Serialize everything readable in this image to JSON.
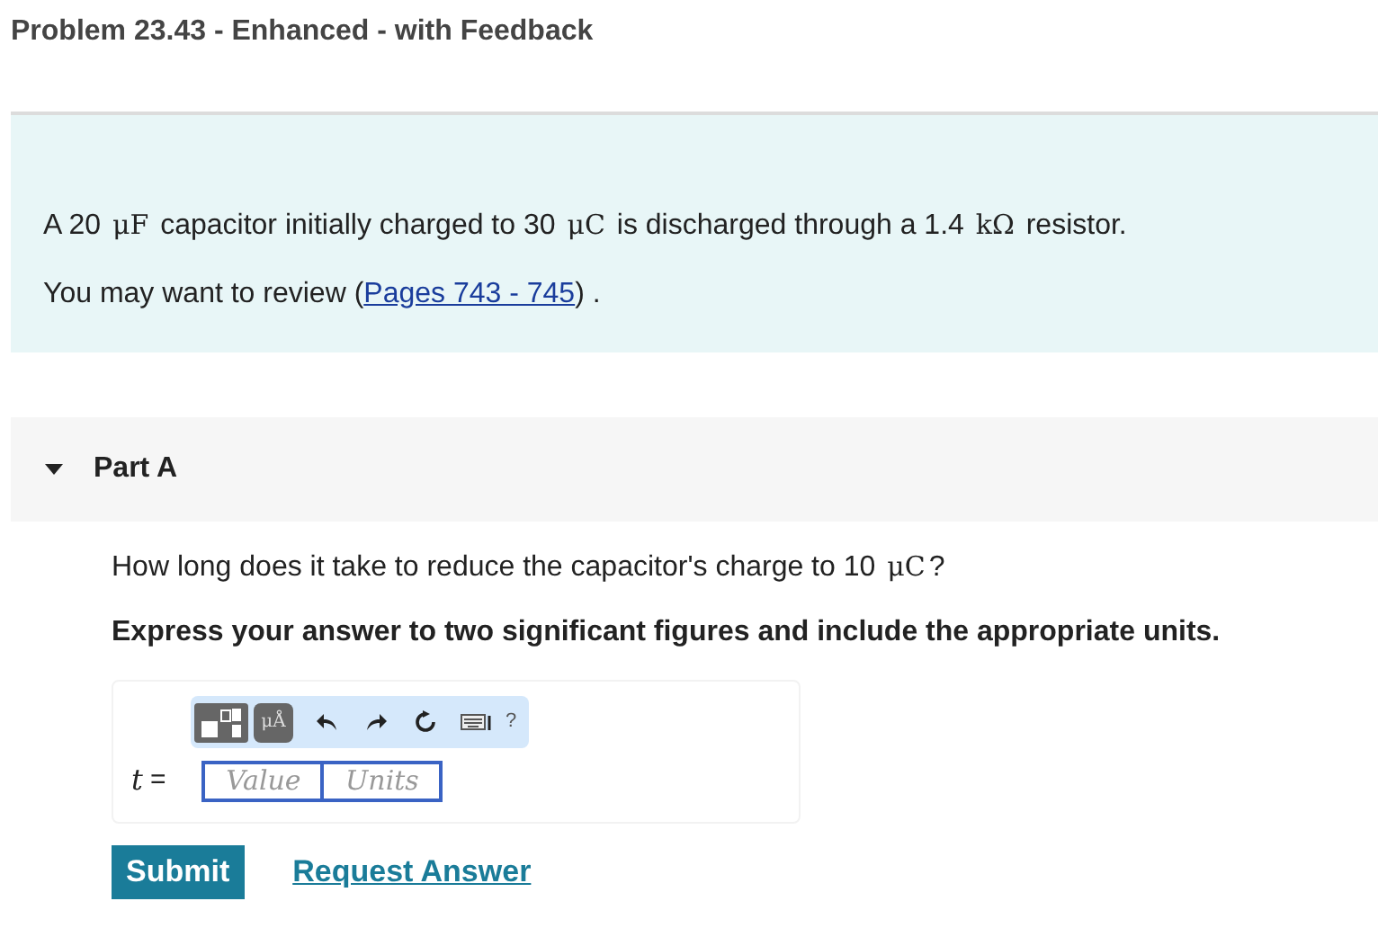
{
  "title": "Problem 23.43 - Enhanced - with Feedback",
  "problem": [
    {
      "kind": "text",
      "text": "A 20 "
    },
    {
      "kind": "math",
      "text": "μF"
    },
    {
      "kind": "text",
      "text": " capacitor initially charged to 30 "
    },
    {
      "kind": "math",
      "text": "μC"
    },
    {
      "kind": "text",
      "text": " is discharged through a 1.4 "
    },
    {
      "kind": "math",
      "text": "kΩ"
    },
    {
      "kind": "text",
      "text": " resistor."
    }
  ],
  "review": {
    "before": "You may want to review (",
    "link": "Pages 743 - 745",
    "after": ") ."
  },
  "part": {
    "label": "Part A",
    "expanded": true,
    "question": [
      {
        "kind": "text",
        "text": "How long does it take to reduce the capacitor's charge to 10 "
      },
      {
        "kind": "math",
        "text": "μC"
      },
      {
        "kind": "text",
        "text": "?"
      }
    ],
    "instruction": "Express your answer to two significant figures and include the appropriate units.",
    "toolbar": {
      "units_button": "μÅ",
      "help": "?"
    },
    "variable": "t",
    "equals": "=",
    "value_field": {
      "placeholder": "Value"
    },
    "units_field": {
      "placeholder": "Units"
    },
    "submit": "Submit",
    "request": "Request Answer"
  }
}
